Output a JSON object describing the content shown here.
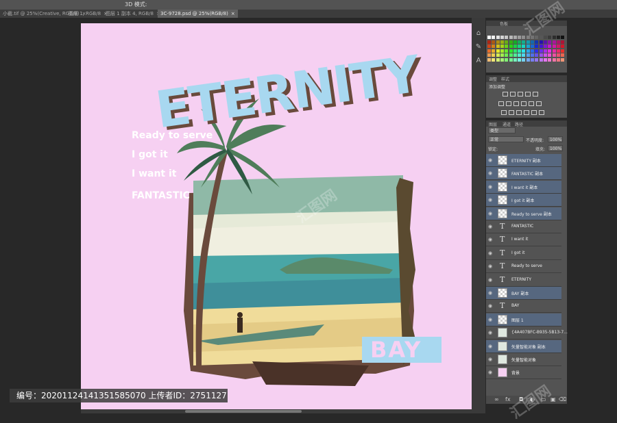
{
  "optbar": {
    "items": [
      "3D 模式:"
    ]
  },
  "tabs": [
    {
      "label": "小截.tif @ 25%(Creative, RGB/8)",
      "active": false
    },
    {
      "label": "图层 1, RGB/8",
      "active": false
    },
    {
      "label": "图层 1 副本 4, RGB/8",
      "active": false
    },
    {
      "label": "3C-9728.psd @ 25%(RGB/8)",
      "active": true
    }
  ],
  "artwork": {
    "title": "ETERNITY",
    "taglines": [
      "Ready to serve",
      "I got it",
      "I want it",
      "FANTASTIC"
    ],
    "badge": "BAY",
    "bg": "#f6d0f2",
    "title_color": "#a8d8f0"
  },
  "watermark": {
    "text": "编号：20201124141351585070 上传者ID：2751127"
  },
  "panels": {
    "swatches_tab": "色板",
    "adjustments_tabs": [
      "调整",
      "样式"
    ],
    "adjustments_label": "添加调整",
    "layers_tabs": [
      "图层",
      "通道",
      "路径"
    ],
    "kind_label": "类型",
    "blend_mode": "正常",
    "opacity_label": "不透明度:",
    "opacity_value": "100%",
    "lock_label": "锁定:",
    "fill_label": "填充:",
    "fill_value": "100%"
  },
  "layers": [
    {
      "name": "ETERNITY 副本",
      "type": "raster",
      "selected": true
    },
    {
      "name": "FANTASTIC 副本",
      "type": "raster",
      "selected": true
    },
    {
      "name": "I want it 副本",
      "type": "raster",
      "selected": true
    },
    {
      "name": "I got it 副本",
      "type": "raster",
      "selected": true
    },
    {
      "name": "Ready to serve 副本",
      "type": "raster",
      "selected": true
    },
    {
      "name": "FANTASTIC",
      "type": "text",
      "selected": false
    },
    {
      "name": "I want it",
      "type": "text",
      "selected": false
    },
    {
      "name": "I got it",
      "type": "text",
      "selected": false
    },
    {
      "name": "Ready to serve",
      "type": "text",
      "selected": false
    },
    {
      "name": "ETERNITY",
      "type": "text",
      "selected": false
    },
    {
      "name": "BAY 副本",
      "type": "raster",
      "selected": true
    },
    {
      "name": "BAY",
      "type": "text",
      "selected": false
    },
    {
      "name": "图层 1",
      "type": "raster",
      "selected": true
    },
    {
      "name": "{4A407BFC-B935-5B13-7...",
      "type": "smart",
      "selected": false
    },
    {
      "name": "矢量智能对象 副本",
      "type": "smart",
      "selected": true
    },
    {
      "name": "矢量智能对象",
      "type": "smart",
      "selected": false
    },
    {
      "name": "背景",
      "type": "background",
      "selected": false
    }
  ],
  "colors": {
    "ui_bg": "#282828",
    "panel": "#535353",
    "selected_row": "#56677f"
  }
}
